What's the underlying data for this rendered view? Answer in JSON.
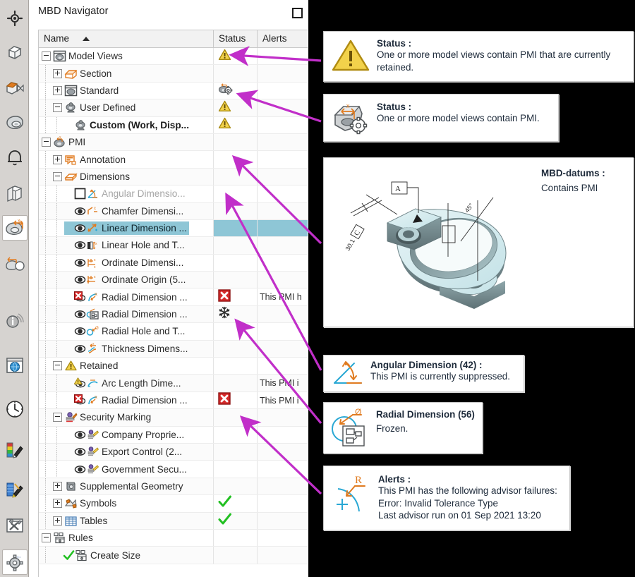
{
  "panel": {
    "title": "MBD Navigator",
    "maximize_label": "Maximize"
  },
  "tree": {
    "columns": [
      "Name",
      "Status",
      "Alerts"
    ],
    "sort_column": "Name",
    "sort_direction": "ascending",
    "rows": [
      {
        "label": "Model Views",
        "indent": 0,
        "expander": "minus",
        "icon": "model-views-icon",
        "status": "warning",
        "alerts": "",
        "state": "normal"
      },
      {
        "label": "Section",
        "indent": 1,
        "expander": "plus",
        "icon": "section-icon",
        "status": "",
        "alerts": "",
        "state": "normal"
      },
      {
        "label": "Standard",
        "indent": 1,
        "expander": "plus",
        "icon": "standard-view-icon",
        "status": "pmi-gear",
        "alerts": "",
        "state": "normal"
      },
      {
        "label": "User Defined",
        "indent": 1,
        "expander": "minus",
        "icon": "user-defined-icon",
        "status": "warning",
        "alerts": "",
        "state": "normal"
      },
      {
        "label": "Custom (Work, Disp...",
        "indent": 2,
        "expander": "none",
        "icon": "user-defined-icon",
        "status": "warning",
        "alerts": "",
        "state": "bold"
      },
      {
        "label": "PMI",
        "indent": 0,
        "expander": "minus",
        "icon": "pmi-icon",
        "status": "",
        "alerts": "",
        "state": "normal"
      },
      {
        "label": "Annotation",
        "indent": 1,
        "expander": "plus",
        "icon": "annotation-icon",
        "status": "",
        "alerts": "",
        "state": "normal"
      },
      {
        "label": "Dimensions",
        "indent": 1,
        "expander": "minus",
        "icon": "dimensions-icon",
        "status": "",
        "alerts": "",
        "state": "normal"
      },
      {
        "label": "Angular Dimensio...",
        "indent": 2,
        "expander": "none",
        "icon": "angular-dimension-icon",
        "prefix": "checkbox-empty",
        "status": "",
        "alerts": "",
        "state": "dim"
      },
      {
        "label": "Chamfer Dimensi...",
        "indent": 2,
        "expander": "none",
        "icon": "chamfer-dimension-icon",
        "prefix": "eye",
        "status": "",
        "alerts": "",
        "state": "normal"
      },
      {
        "label": "Linear Dimension ...",
        "indent": 2,
        "expander": "none",
        "icon": "linear-dimension-icon",
        "prefix": "eye",
        "status": "",
        "alerts": "",
        "state": "selected"
      },
      {
        "label": "Linear Hole and T...",
        "indent": 2,
        "expander": "none",
        "icon": "linear-hole-icon",
        "prefix": "eye",
        "status": "",
        "alerts": "",
        "state": "normal"
      },
      {
        "label": "Ordinate Dimensi...",
        "indent": 2,
        "expander": "none",
        "icon": "ordinate-dimension-icon",
        "prefix": "eye",
        "status": "",
        "alerts": "",
        "state": "normal"
      },
      {
        "label": "Ordinate Origin (5...",
        "indent": 2,
        "expander": "none",
        "icon": "ordinate-origin-icon",
        "prefix": "eye",
        "status": "",
        "alerts": "",
        "state": "normal"
      },
      {
        "label": "Radial Dimension ...",
        "indent": 2,
        "expander": "none",
        "icon": "radial-dimension-icon",
        "prefix": "error",
        "status": "error",
        "alerts": "This PMI h",
        "state": "normal"
      },
      {
        "label": "Radial Dimension ...",
        "indent": 2,
        "expander": "none",
        "icon": "radial-frozen-icon",
        "prefix": "eye",
        "status": "frozen",
        "alerts": "",
        "state": "normal"
      },
      {
        "label": "Radial Hole and T...",
        "indent": 2,
        "expander": "none",
        "icon": "radial-hole-icon",
        "prefix": "eye",
        "status": "",
        "alerts": "",
        "state": "normal"
      },
      {
        "label": "Thickness Dimens...",
        "indent": 2,
        "expander": "none",
        "icon": "thickness-dimension-icon",
        "prefix": "eye",
        "status": "",
        "alerts": "",
        "state": "normal"
      },
      {
        "label": "Retained",
        "indent": 1,
        "expander": "minus",
        "icon": "warning-icon",
        "status": "",
        "alerts": "",
        "state": "normal"
      },
      {
        "label": "Arc Length Dime...",
        "indent": 2,
        "expander": "none",
        "icon": "arc-length-dimension-icon",
        "prefix": "warning-eye",
        "status": "",
        "alerts": "This PMI i",
        "state": "normal"
      },
      {
        "label": "Radial Dimension ...",
        "indent": 2,
        "expander": "none",
        "icon": "radial-dimension-icon",
        "prefix": "error",
        "status": "error",
        "alerts": "This PMI i",
        "state": "normal"
      },
      {
        "label": "Security Marking",
        "indent": 1,
        "expander": "minus",
        "icon": "security-marking-icon",
        "status": "",
        "alerts": "",
        "state": "normal"
      },
      {
        "label": "Company Proprie...",
        "indent": 2,
        "expander": "none",
        "icon": "security-item-icon",
        "prefix": "eye",
        "status": "",
        "alerts": "",
        "state": "normal"
      },
      {
        "label": "Export Control (2...",
        "indent": 2,
        "expander": "none",
        "icon": "security-item-icon",
        "prefix": "eye",
        "status": "",
        "alerts": "",
        "state": "normal"
      },
      {
        "label": "Government Secu...",
        "indent": 2,
        "expander": "none",
        "icon": "security-item-icon",
        "prefix": "eye",
        "status": "",
        "alerts": "",
        "state": "normal"
      },
      {
        "label": "Supplemental Geometry",
        "indent": 1,
        "expander": "plus",
        "icon": "supplemental-geometry-icon",
        "status": "",
        "alerts": "",
        "state": "normal"
      },
      {
        "label": "Symbols",
        "indent": 1,
        "expander": "plus",
        "icon": "symbols-icon",
        "status": "check",
        "alerts": "",
        "state": "normal"
      },
      {
        "label": "Tables",
        "indent": 1,
        "expander": "plus",
        "icon": "tables-icon",
        "status": "check",
        "alerts": "",
        "state": "normal"
      },
      {
        "label": "Rules",
        "indent": 0,
        "expander": "minus",
        "icon": "rules-icon",
        "status": "",
        "alerts": "",
        "state": "normal"
      },
      {
        "label": "Create Size",
        "indent": 1,
        "expander": "none",
        "icon": "rules-icon",
        "prefix": "check",
        "status": "",
        "alerts": "",
        "state": "normal"
      }
    ]
  },
  "callouts": [
    {
      "id": "status-retained",
      "icon": "warning-triangle-icon",
      "title": "Status :",
      "body": "One or more model views contain PMI that are currently retained."
    },
    {
      "id": "status-contains-pmi",
      "icon": "pmi-model-gear-icon",
      "title": "Status :",
      "body": "One or more model views contain PMI."
    },
    {
      "id": "mbd-datums",
      "icon": "bracket-3d-model-image",
      "title": "MBD-datums :",
      "body": "Contains PMI"
    },
    {
      "id": "angular-dimension",
      "icon": "angular-dimension-large-icon",
      "title": "Angular Dimension (42) :",
      "body": "This PMI is currently suppressed."
    },
    {
      "id": "radial-dimension",
      "icon": "radial-frozen-large-icon",
      "title": "Radial Dimension (56)",
      "body": "Frozen."
    },
    {
      "id": "alerts",
      "icon": "radius-alert-large-icon",
      "title": "Alerts :",
      "body_lines": [
        "This PMI has the following advisor failures:",
        "Error: Invalid Tolerance Type",
        "Last advisor run on 01 Sep 2021 13:20"
      ]
    }
  ],
  "toolbar": {
    "items": [
      {
        "name": "assembly-navigator-icon",
        "selected": false
      },
      {
        "name": "part-navigator-icon",
        "selected": false
      },
      {
        "name": "constraint-navigator-icon",
        "selected": false
      },
      {
        "name": "model-view-navigator-icon",
        "selected": false
      },
      {
        "name": "reuse-library-icon",
        "selected": false
      },
      {
        "name": "history-icon",
        "selected": false
      },
      {
        "name": "mbd-navigator-icon",
        "selected": true
      },
      {
        "name": "view-manager-icon",
        "selected": false
      },
      {
        "name": "information-icon",
        "selected": false
      },
      {
        "name": "web-browser-icon",
        "selected": false
      },
      {
        "name": "history-clock-icon",
        "selected": false
      },
      {
        "name": "render-palette-icon",
        "selected": false
      },
      {
        "name": "system-materials-icon",
        "selected": false
      },
      {
        "name": "customer-defaults-icon",
        "selected": false
      },
      {
        "name": "roles-icon",
        "selected": true
      }
    ]
  },
  "colors": {
    "accent_orange": "#e07b20",
    "warning_yellow": "#f2d24b",
    "error_red": "#d42a2a",
    "ok_green": "#22c022",
    "selection_blue": "#8ec6d6",
    "arrow_magenta": "#c12fc9",
    "panel_bg": "#d6d3d0"
  }
}
